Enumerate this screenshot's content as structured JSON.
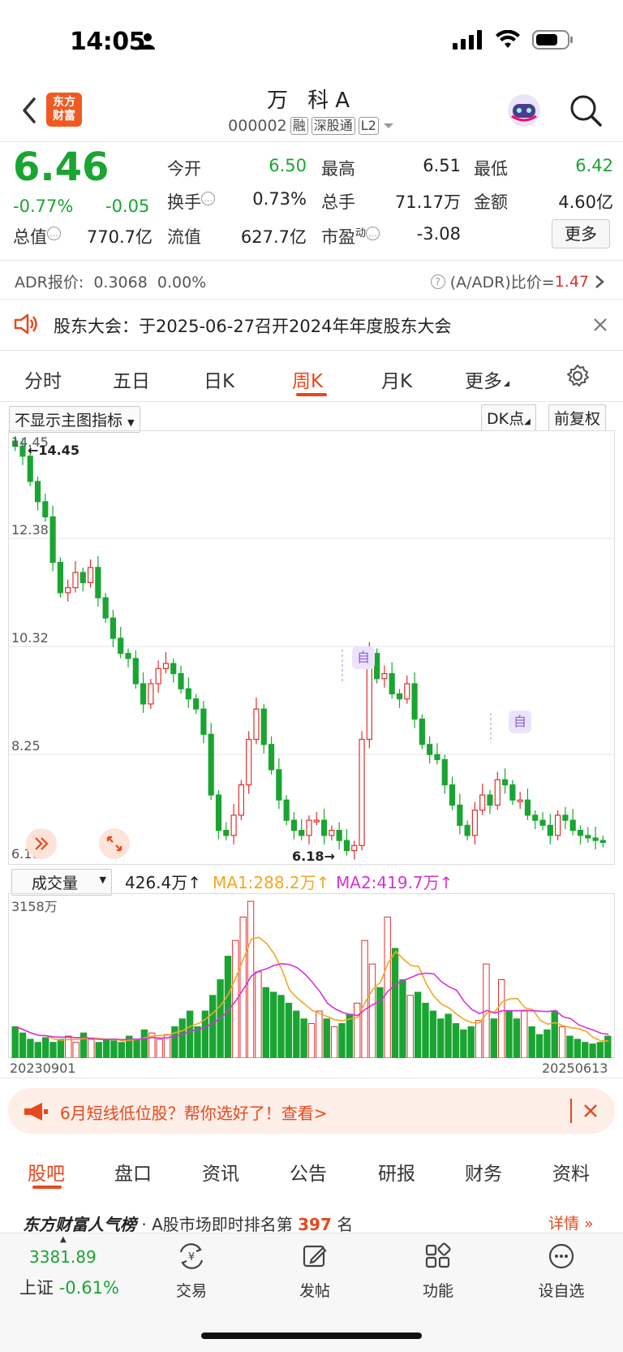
{
  "status": {
    "time": "14:05"
  },
  "header": {
    "logo_line1": "东方",
    "logo_line2": "财富",
    "title": "万 科A",
    "code": "000002",
    "tags": [
      "融",
      "深股通",
      "L2"
    ]
  },
  "quote": {
    "price": "6.46",
    "change_pct": "-0.77%",
    "change_abs": "-0.05",
    "fields": {
      "open_label": "今开",
      "open": "6.50",
      "high_label": "最高",
      "high": "6.51",
      "low_label": "最低",
      "low": "6.42",
      "turnover_label": "换手",
      "turnover": "0.73%",
      "volume_label": "总手",
      "volume": "71.17万",
      "amount_label": "金额",
      "amount": "4.60亿",
      "mktcap_label": "总值",
      "mktcap": "770.7亿",
      "float_label": "流值",
      "float": "627.7亿",
      "pe_label": "市盈",
      "pe_sup": "动",
      "pe": "-3.08"
    },
    "more_label": "更多"
  },
  "adr": {
    "label": "ADR报价:",
    "price": "0.3068",
    "pct": "0.00%",
    "ratio_label": "(A/ADR)比价=",
    "ratio": "1.47"
  },
  "notice": {
    "text": "股东大会：于2025-06-27召开2024年年度股东大会"
  },
  "chart_tabs": [
    "分时",
    "五日",
    "日K",
    "周K",
    "月K",
    "更多"
  ],
  "chart_controls": {
    "indicator": "不显示主图指标",
    "dk": "DK点",
    "adjust": "前复权",
    "volume_select": "成交量",
    "vol_value": "426.4万",
    "ma1": "MA1:288.2万",
    "ma2": "MA2:419.7万",
    "vol_max": "3158万",
    "date_start": "20230901",
    "date_end": "20250613",
    "high_marker": "14.45",
    "low_marker": "6.18",
    "auto_mark": "自"
  },
  "chart_data": {
    "type": "candlestick",
    "y_ticks": [
      "14.45",
      "12.38",
      "10.32",
      "8.25",
      "6.18"
    ],
    "ylim": [
      6.18,
      14.45
    ],
    "x_start": "20230901",
    "x_end": "20250613",
    "volume_max_label": "3158万",
    "latest_volume": "426.4万",
    "ma1": "288.2万",
    "ma2": "419.7万",
    "colors": {
      "up": "#e02f2f",
      "down": "#1aa532",
      "ma1": "#f5a623",
      "ma2": "#d633d6"
    }
  },
  "promo": {
    "text": "6月短线低位股？帮你选好了！查看>"
  },
  "sub_tabs": [
    "股吧",
    "盘口",
    "资讯",
    "公告",
    "研报",
    "财务",
    "资料"
  ],
  "rank": {
    "brand": "东方财富人气榜",
    "text": "· A股市场即时排名第",
    "num": "397",
    "suffix": "名",
    "detail": "详情"
  },
  "bottom_nav": {
    "index_value": "3381.89",
    "index_name": "上证",
    "index_change": "-0.61%",
    "items": [
      "交易",
      "发帖",
      "功能",
      "设自选"
    ]
  }
}
